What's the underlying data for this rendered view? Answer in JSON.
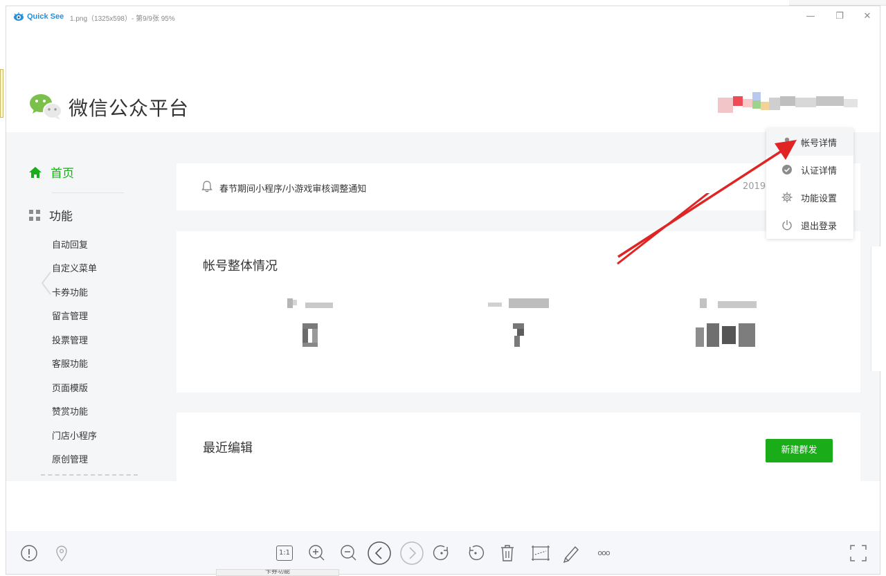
{
  "viewer": {
    "app_name": "Quick See",
    "file_info": "1.png（1325x598）- 第9/9张 95%",
    "minimize_glyph": "—",
    "maximize_glyph": "❐",
    "close_glyph": "✕"
  },
  "wechat": {
    "platform_title": "微信公众平台",
    "sidebar": {
      "home_label": "首页",
      "function_label": "功能",
      "items": [
        "自动回复",
        "自定义菜单",
        "卡券功能",
        "留言管理",
        "投票管理",
        "客服功能",
        "页面模版",
        "赞赏功能",
        "门店小程序",
        "原创管理"
      ]
    },
    "notice": {
      "text": "春节期间小程序/小游戏审核调整通知",
      "date": "2019-"
    },
    "overview": {
      "title": "帐号整体情况"
    },
    "recent": {
      "title": "最近编辑",
      "new_mass_button": "新建群发"
    },
    "account_menu": {
      "items": [
        {
          "label": "帐号详情",
          "icon": "user-icon"
        },
        {
          "label": "认证详情",
          "icon": "verified-check-icon"
        },
        {
          "label": "功能设置",
          "icon": "gear-icon"
        },
        {
          "label": "退出登录",
          "icon": "power-icon"
        }
      ]
    }
  },
  "toolbar": {
    "buttons": [
      "info-icon",
      "location-icon",
      "actual-size-icon",
      "zoom-in-icon",
      "zoom-out-icon",
      "previous-icon",
      "next-icon",
      "rotate-left-icon",
      "rotate-right-icon",
      "delete-icon",
      "crop-icon",
      "edit-icon",
      "more-icon",
      "fullscreen-icon"
    ],
    "actual_size_label": "1:1",
    "more_label": "ooo"
  },
  "background": {
    "bottom_caption": "卡券功能"
  },
  "colors": {
    "wechat_green": "#1aad19",
    "annotation_red": "#e02424",
    "quicksee_blue": "#2b8fd6"
  }
}
